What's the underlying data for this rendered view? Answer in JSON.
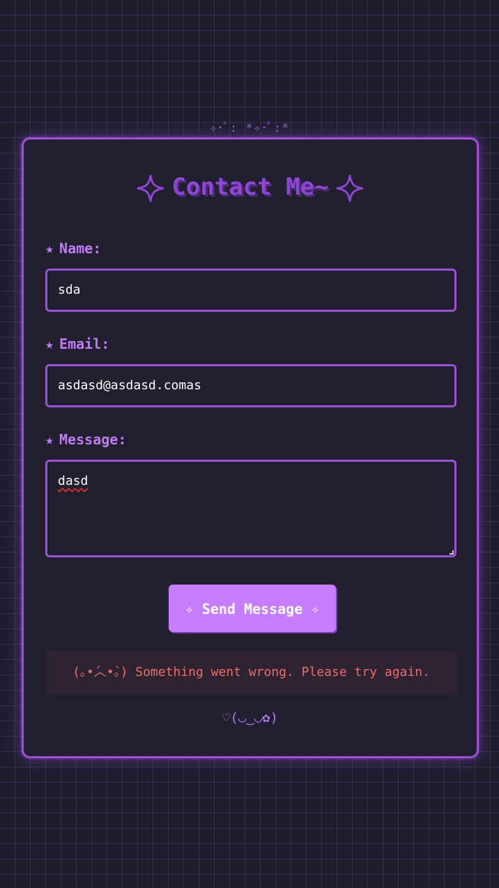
{
  "decoration": {
    "top_sparkles": "✧･ﾟ: *✧･ﾟ:*"
  },
  "form": {
    "title": "Contact Me~",
    "title_icon": "four-point-star-icon",
    "fields": {
      "name": {
        "label": "Name:",
        "bullet": "★",
        "value": "sda"
      },
      "email": {
        "label": "Email:",
        "bullet": "★",
        "value": "asdasd@asdasd.comas"
      },
      "message": {
        "label": "Message:",
        "bullet": "★",
        "value": "dasd"
      }
    },
    "submit_label": "✧ Send Message ✧",
    "error_message": "(｡•́︿•̀｡) Something went wrong. Please try again.",
    "footer": "♡(◡‿◡✿)"
  },
  "colors": {
    "accent": "#9d50d9",
    "button": "#c77dfb",
    "label": "#c07cf6",
    "error": "#f06b6b",
    "background": "#1f1e2e"
  }
}
